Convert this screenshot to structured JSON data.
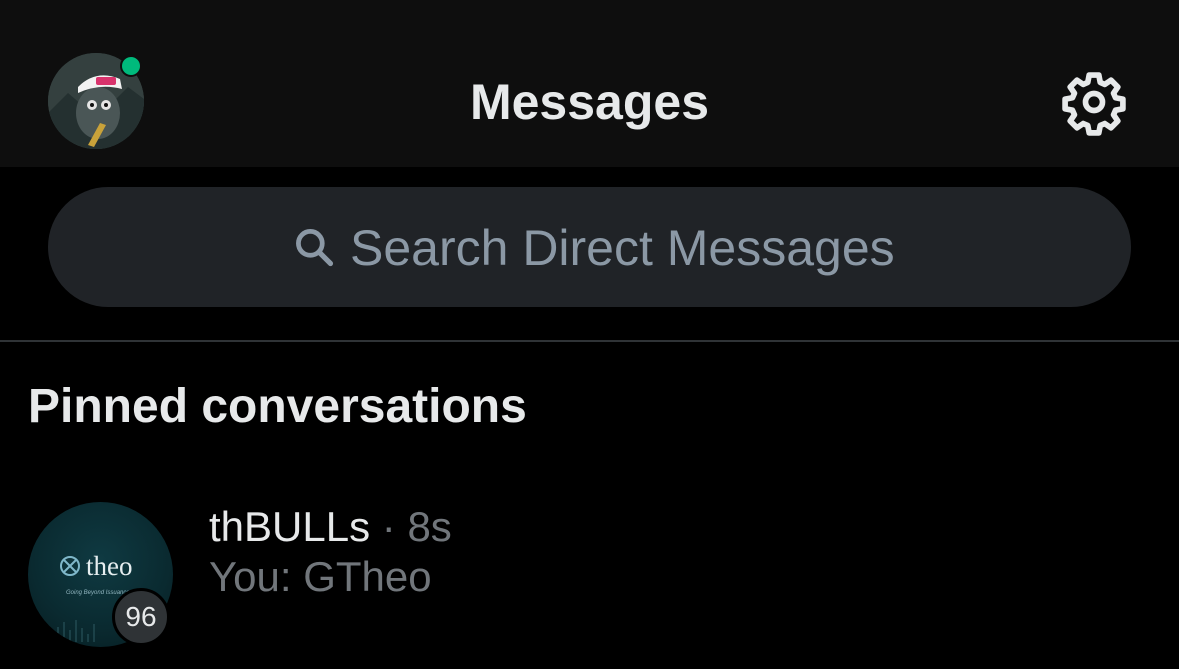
{
  "header": {
    "title": "Messages",
    "avatar_icon": "user-avatar",
    "settings_icon": "gear-icon",
    "online_color": "#00ba7c"
  },
  "search": {
    "placeholder": "Search Direct Messages",
    "icon": "search-icon"
  },
  "pinned": {
    "section_title": "Pinned conversations",
    "conversations": [
      {
        "name": "thBULLs",
        "separator": "·",
        "time": "8s",
        "preview": "You: GTheo",
        "badge": "96",
        "avatar_logo_text": "theo",
        "avatar_tagline": "Going Beyond Issuance"
      }
    ]
  },
  "colors": {
    "background": "#000000",
    "header_bg": "#0e0e0e",
    "search_bg": "#202327",
    "primary_text": "#e7e9ea",
    "secondary_text": "#71767b"
  }
}
